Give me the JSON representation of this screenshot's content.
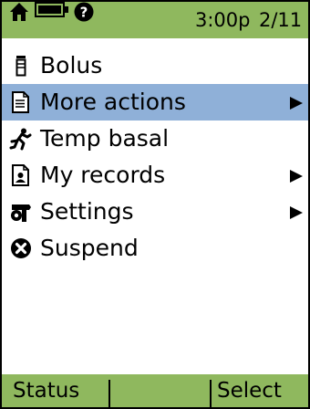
{
  "status_bar": {
    "icons": [
      "home-icon",
      "battery-icon",
      "help-icon"
    ],
    "time": "3:00p",
    "date": "2/11"
  },
  "menu": {
    "items": [
      {
        "label": "Bolus",
        "icon": "vial-icon",
        "has_submenu": false,
        "selected": false
      },
      {
        "label": "More actions",
        "icon": "document-icon",
        "has_submenu": true,
        "selected": true
      },
      {
        "label": "Temp basal",
        "icon": "running-person-icon",
        "has_submenu": false,
        "selected": false
      },
      {
        "label": "My records",
        "icon": "records-icon",
        "has_submenu": true,
        "selected": false
      },
      {
        "label": "Settings",
        "icon": "settings-tools-icon",
        "has_submenu": true,
        "selected": false
      },
      {
        "label": "Suspend",
        "icon": "suspend-icon",
        "has_submenu": false,
        "selected": false
      }
    ]
  },
  "softkeys": {
    "left_label": "Status",
    "right_label": "Select"
  },
  "colors": {
    "bar_green": "#8fb85e",
    "selection_blue": "#8fb0d8"
  }
}
